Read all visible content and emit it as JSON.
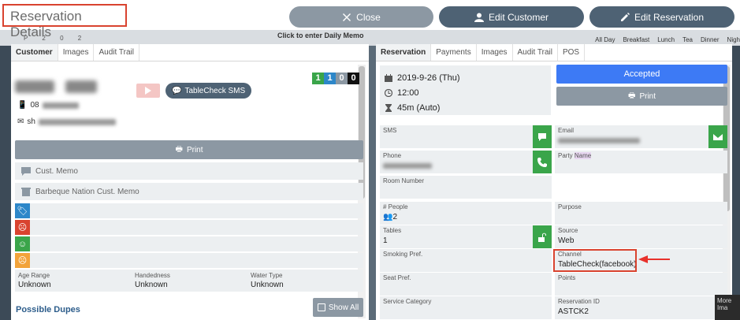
{
  "header": {
    "title": "Reservation Details",
    "buttons": {
      "close": "Close",
      "edit_customer": "Edit Customer",
      "edit_reservation": "Edit Reservation"
    }
  },
  "background": {
    "enter_memo": "Click to enter Daily Memo",
    "digits": "P 2 0 2",
    "meals": [
      "All Day",
      "Breakfast",
      "Lunch",
      "Tea",
      "Dinner",
      "Nigh"
    ]
  },
  "left_panel": {
    "tabs": [
      "Customer",
      "Images",
      "Audit Trail"
    ],
    "active_tab": "Customer",
    "tablecheck_sms": "TableCheck SMS",
    "phone_prefix": "08",
    "email_prefix": "sh",
    "counts": [
      "1",
      "1",
      "0",
      "0"
    ],
    "print": "Print",
    "cust_memo": "Cust. Memo",
    "venue_memo": "Barbeque Nation Cust. Memo",
    "attributes": [
      {
        "label": "Age Range",
        "value": "Unknown"
      },
      {
        "label": "Handedness",
        "value": "Unknown"
      },
      {
        "label": "Water Type",
        "value": "Unknown"
      }
    ],
    "possible_dupes": "Possible Dupes",
    "show_all": "Show All"
  },
  "right_panel": {
    "tabs": [
      "Reservation",
      "Payments",
      "Images",
      "Audit Trail",
      "POS"
    ],
    "active_tab": "Reservation",
    "date": "2019-9-26 (Thu)",
    "time": "12:00",
    "duration": "45m (Auto)",
    "status_button": "Accepted",
    "print": "Print",
    "fields": {
      "sms": {
        "label": "SMS",
        "value": ""
      },
      "email": {
        "label": "Email",
        "value": ""
      },
      "phone": {
        "label": "Phone",
        "value": ""
      },
      "party_name": {
        "label_prefix": "Party ",
        "label_highlight": "Name",
        "value": ""
      },
      "room_number": {
        "label": "Room Number",
        "value": ""
      },
      "people": {
        "label": "# People",
        "value": "2"
      },
      "purpose": {
        "label": "Purpose",
        "value": ""
      },
      "tables": {
        "label": "Tables",
        "value": "1"
      },
      "source": {
        "label": "Source",
        "value": "Web"
      },
      "smoking": {
        "label": "Smoking Pref.",
        "value": ""
      },
      "channel": {
        "label": "Channel",
        "value": "TableCheck(facebook)"
      },
      "seat": {
        "label": "Seat Pref.",
        "value": ""
      },
      "points": {
        "label": "Points",
        "value": ""
      },
      "service_category": {
        "label": "Service Category",
        "value": ""
      },
      "reservation_id": {
        "label": "Reservation ID",
        "value": "ASTCK2"
      }
    }
  },
  "overlay": {
    "more": "More",
    "ima": "Ima"
  },
  "colors": {
    "accent_blue": "#3d7af5",
    "dark_button": "#4e6274",
    "gray_button": "#8c98a3",
    "green": "#3aa54a",
    "highlight_red": "#d9432f"
  }
}
